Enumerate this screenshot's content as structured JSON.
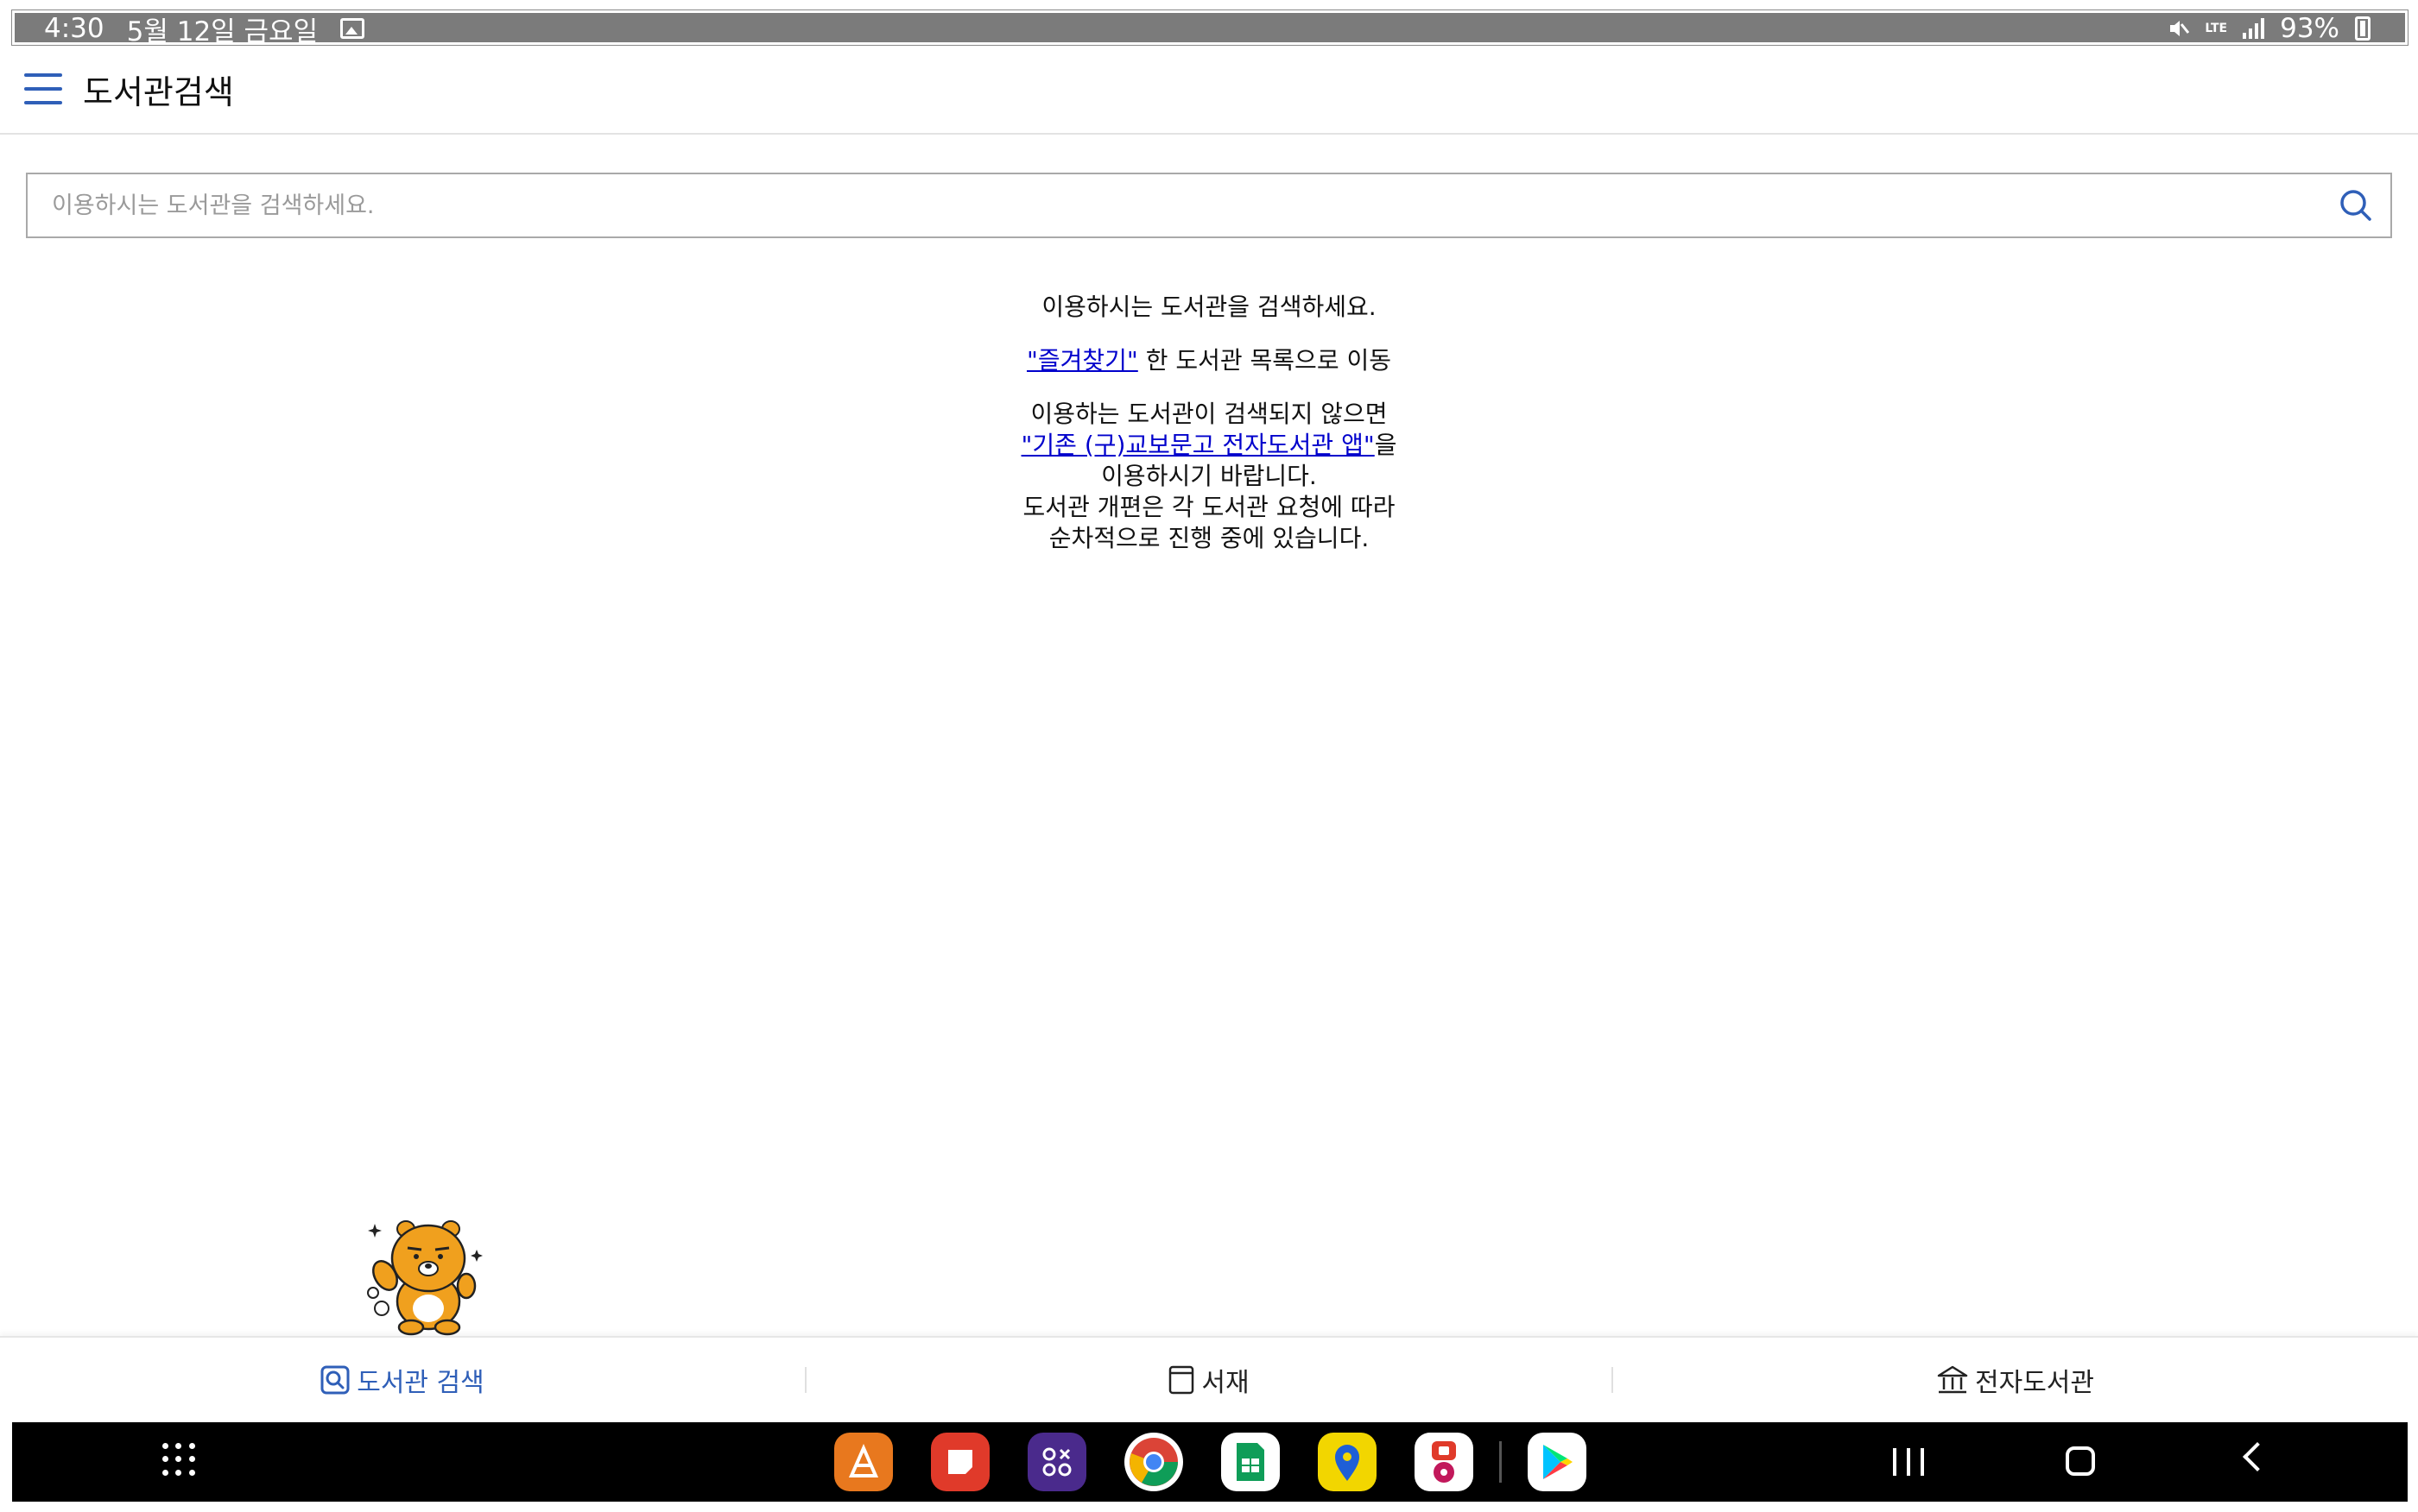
{
  "status_bar": {
    "time": "4:30",
    "date": "5월 12일 금요일",
    "network": "LTE",
    "battery": "93%"
  },
  "header": {
    "title": "도서관검색"
  },
  "search": {
    "placeholder": "이용하시는 도서관을 검색하세요."
  },
  "guide": {
    "line1": "이용하시는 도서관을 검색하세요.",
    "favorites_link": "\"즐겨찾기\"",
    "favorites_rest": " 한 도서관 목록으로 이동",
    "notfound_line": "이용하는 도서관이 검색되지 않으면",
    "legacy_link": "\"기존 (구)교보문고 전자도서관 앱\"",
    "legacy_suffix": "을",
    "use_line": "이용하시기 바랍니다.",
    "reform_line1": "도서관 개편은 각 도서관 요청에 따라",
    "reform_line2": "순차적으로 진행 중에 있습니다."
  },
  "tabs": [
    {
      "label": "도서관 검색",
      "icon": "search-icon",
      "active": true
    },
    {
      "label": "서재",
      "icon": "book-icon",
      "active": false
    },
    {
      "label": "전자도서관",
      "icon": "library-icon",
      "active": false
    }
  ],
  "colors": {
    "accent": "#2f5fb8",
    "link": "#0000cc",
    "status_bar": "#7b7b7b"
  }
}
